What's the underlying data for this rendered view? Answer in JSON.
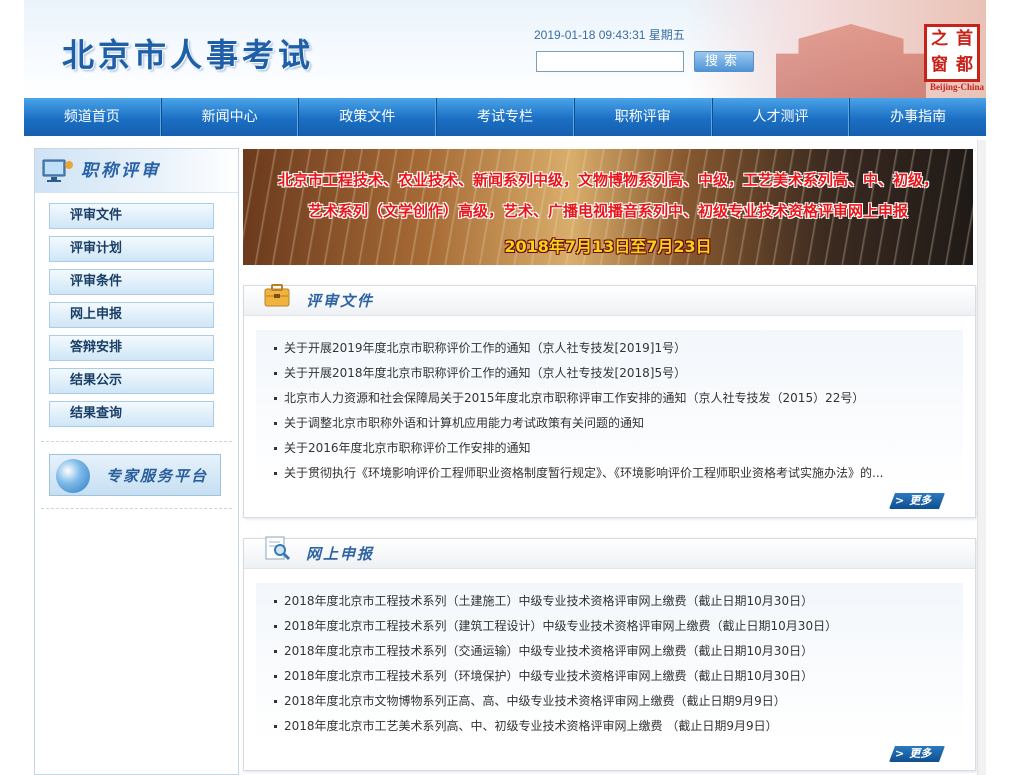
{
  "header": {
    "site_title": "北京市人事考试",
    "datetime": "2019-01-18 09:43:31 星期五",
    "search_value": "",
    "search_label": "搜索",
    "seal_chars": [
      "之",
      "首",
      "窗",
      "都"
    ],
    "seal_caption": "Beijing-China"
  },
  "nav": {
    "items": [
      "频道首页",
      "新闻中心",
      "政策文件",
      "考试专栏",
      "职称评审",
      "人才测评",
      "办事指南"
    ]
  },
  "sidebar": {
    "title": "职称评审",
    "items": [
      "评审文件",
      "评审计划",
      "评审条件",
      "网上申报",
      "答辩安排",
      "结果公示",
      "结果查询"
    ],
    "expert_label": "专家服务平台"
  },
  "banner": {
    "line1": "北京市工程技术、农业技术、新闻系列中级，文物博物系列高、中级，工艺美术系列高、中、初级，",
    "line2": "艺术系列（文学创作）高级，艺术、广播电视播音系列中、初级专业技术资格评审网上申报",
    "line3": "2018年7月13日至7月23日"
  },
  "panels": {
    "review_docs": {
      "title": "评审文件",
      "items": [
        "关于开展2019年度北京市职称评价工作的通知（京人社专技发[2019]1号）",
        "关于开展2018年度北京市职称评价工作的通知（京人社专技发[2018]5号）",
        "北京市人力资源和社会保障局关于2015年度北京市职称评审工作安排的通知（京人社专技发（2015）22号）",
        "关于调整北京市职称外语和计算机应用能力考试政策有关问题的通知",
        "关于2016年度北京市职称评价工作安排的通知",
        "关于贯彻执行《环境影响评价工程师职业资格制度暂行规定》、《环境影响评价工程师职业资格考试实施办法》的..."
      ],
      "more": "更多"
    },
    "online_apply": {
      "title": "网上申报",
      "items": [
        "2018年度北京市工程技术系列（土建施工）中级专业技术资格评审网上缴费（截止日期10月30日）",
        "2018年度北京市工程技术系列（建筑工程设计）中级专业技术资格评审网上缴费（截止日期10月30日）",
        "2018年度北京市工程技术系列（交通运输）中级专业技术资格评审网上缴费（截止日期10月30日）",
        "2018年度北京市工程技术系列（环境保护）中级专业技术资格评审网上缴费（截止日期10月30日）",
        "2018年度北京市文物博物系列正高、高、中级专业技术资格评审网上缴费（截止日期9月9日）",
        "2018年度北京市工艺美术系列高、中、初级专业技术资格评审网上缴费  （截止日期9月9日）"
      ],
      "more": "更多"
    }
  },
  "colors": {
    "nav_blue": "#1b6fc4",
    "title_blue": "#1e5fa8",
    "banner_red": "#e8161a",
    "banner_yellow": "#f6d21a",
    "seal_red": "#c8231b"
  }
}
